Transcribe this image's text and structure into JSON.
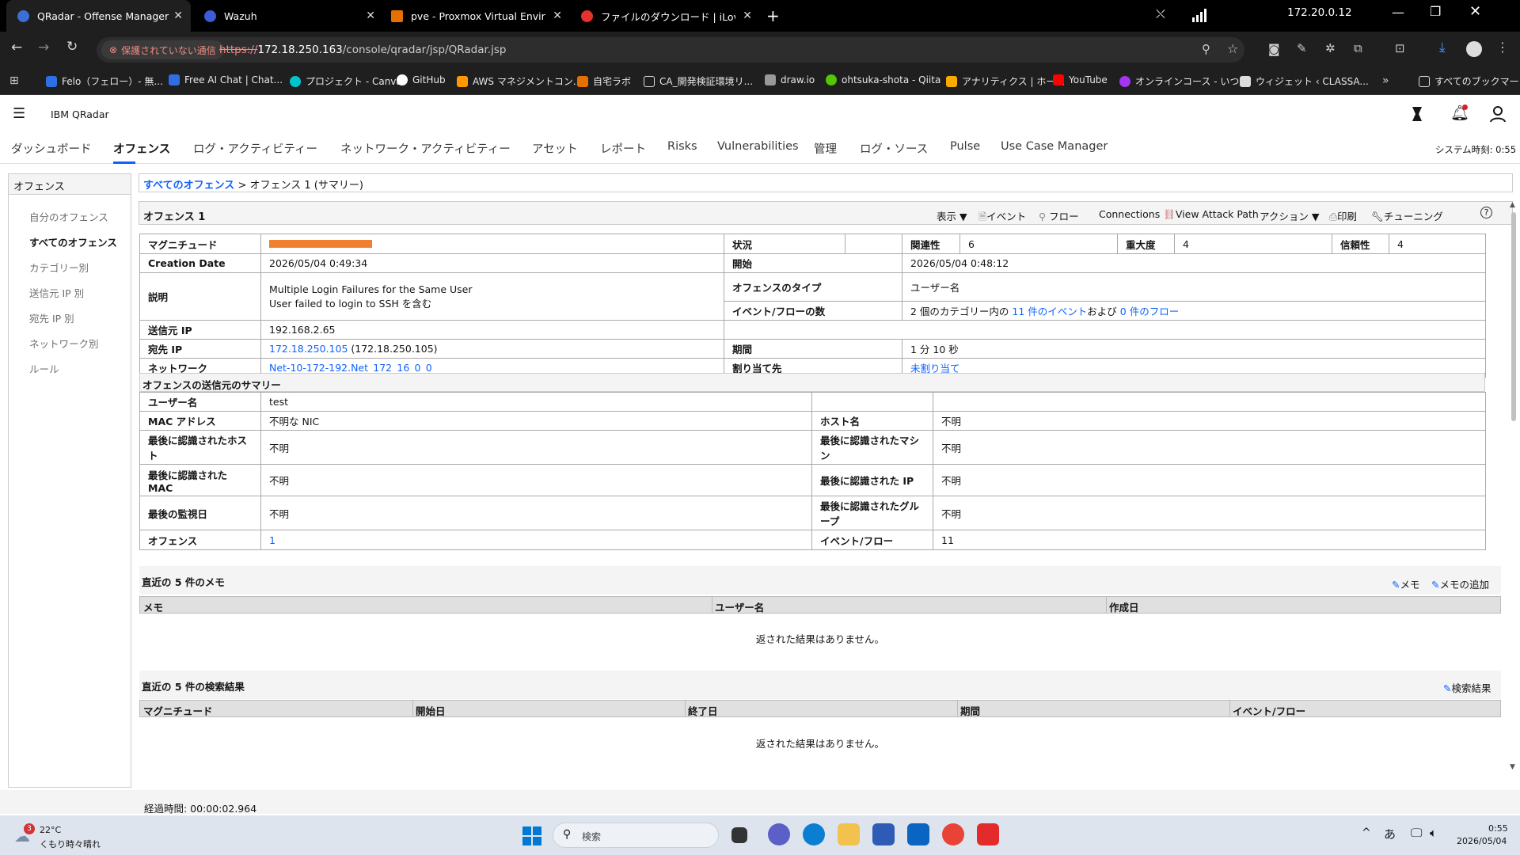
{
  "browser": {
    "tabs": [
      {
        "title": "QRadar - Offense Manager",
        "color": "#3b6fd4",
        "active": true
      },
      {
        "title": "Wazuh",
        "color": "#3b5bd8"
      },
      {
        "title": "pve - Proxmox Virtual Environm",
        "color": "#e57000"
      },
      {
        "title": "ファイルのダウンロード | iLovePDF",
        "color": "#e5322d"
      }
    ],
    "new_tab": "+",
    "ip": "172.20.0.12",
    "security_label": "保護されていない通信",
    "url_scheme": "https://",
    "url_host": "172.18.250.163",
    "url_path": "/console/qradar/jsp/QRadar.jsp",
    "bookmarks": [
      {
        "label": "Felo（フェロー）- 無...",
        "color": "#2f6fe4"
      },
      {
        "label": "Free AI Chat | Chat...",
        "color": "#2f6fe4"
      },
      {
        "label": "プロジェクト - Canva",
        "color": "#00c4cc"
      },
      {
        "label": "GitHub",
        "color": "#ffffff"
      },
      {
        "label": "AWS マネジメントコン...",
        "color": "#ff9900"
      },
      {
        "label": "自宅ラボ",
        "color": "#e57000"
      },
      {
        "label": "CA_開発検証環境リ...",
        "color": "#dddddd"
      },
      {
        "label": "draw.io",
        "color": "#999999"
      },
      {
        "label": "ohtsuka-shota - Qiita",
        "color": "#55c500"
      },
      {
        "label": "アナリティクス | ホーム",
        "color": "#f9ab00"
      },
      {
        "label": "YouTube",
        "color": "#ff0000"
      },
      {
        "label": "オンラインコース - いつ...",
        "color": "#a435f0"
      },
      {
        "label": "ウィジェット ‹ CLASSA...",
        "color": "#dddddd"
      }
    ],
    "more_bookmarks": "»",
    "all_bookmarks": "すべてのブックマーク"
  },
  "app": {
    "brand": "IBM QRadar",
    "system_time": "システム時刻: 0:55",
    "nav_tabs": [
      "ダッシュボード",
      "オフェンス",
      "ログ・アクティビティー",
      "ネットワーク・アクティビティー",
      "アセット",
      "レポート",
      "Risks",
      "Vulnerabilities",
      "管理",
      "ログ・ソース",
      "Pulse",
      "Use Case Manager"
    ],
    "active_tab": "オフェンス"
  },
  "sidebar": {
    "title": "オフェンス",
    "items": [
      "自分のオフェンス",
      "すべてのオフェンス",
      "カテゴリー別",
      "送信元 IP 別",
      "宛先 IP 別",
      "ネットワーク別",
      "ルール"
    ],
    "active": "すべてのオフェンス"
  },
  "breadcrumb": {
    "link": "すべてのオフェンス",
    "rest": " > オフェンス 1 (サマリー)"
  },
  "toolbar": {
    "title": "オフェンス 1",
    "display": "表示 ▼",
    "events": "イベント",
    "flows": "フロー",
    "connections": "Connections",
    "attack_path": "View Attack Path",
    "actions": "アクション ▼",
    "print": "印刷",
    "tuning": "チューニング",
    "help": "?"
  },
  "offense": {
    "magnitude_label": "マグニチュード",
    "magnitude_pct": 0.48,
    "status_label": "状況",
    "relevance_label": "関連性",
    "relevance": "6",
    "severity_label": "重大度",
    "severity": "4",
    "credibility_label": "信頼性",
    "credibility": "4",
    "creation_label": "Creation Date",
    "creation": "2026/05/04 0:49:34",
    "start_label": "開始",
    "start": "2026/05/04 0:48:12",
    "desc_label": "説明",
    "desc1": "Multiple Login Failures for the Same User",
    "desc2": "User failed to login to SSH を含む",
    "type_label": "オフェンスのタイプ",
    "type": "ユーザー名",
    "count_label": "イベント/フローの数",
    "count_pre": "2 個のカテゴリー内の ",
    "count_events": "11 件のイベント",
    "count_mid": "および ",
    "count_flows": "0 件のフロー",
    "src_label": "送信元 IP",
    "src": "192.168.2.65",
    "dst_label": "宛先 IP",
    "dst_link": "172.18.250.105",
    "dst_rest": " (172.18.250.105)",
    "duration_label": "期間",
    "duration": "1 分 10 秒",
    "network_label": "ネットワーク",
    "network": "Net-10-172-192.Net_172_16_0_0",
    "assign_label": "割り当て先",
    "assign": "未割り当て"
  },
  "source_summary": {
    "title": "オフェンスの送信元のサマリー",
    "user_label": "ユーザー名",
    "user": "test",
    "mac_label": "MAC アドレス",
    "mac": "不明な NIC",
    "host_label": "ホスト名",
    "host": "不明",
    "last_host_label": "最後に認識されたホスト",
    "last_host": "不明",
    "last_machine_label": "最後に認識されたマシン",
    "last_machine": "不明",
    "last_mac_label": "最後に認識された MAC",
    "last_mac": "不明",
    "last_ip_label": "最後に認識された IP",
    "last_ip": "不明",
    "last_obs_label": "最後の監視日",
    "last_obs": "不明",
    "last_group_label": "最後に認識されたグループ",
    "last_group": "不明",
    "offense_label": "オフェンス",
    "offense": "1",
    "ef_label": "イベント/フロー",
    "ef": "11"
  },
  "notes": {
    "title": "直近の 5 件のメモ",
    "memo_btn": "メモ",
    "add_btn": "メモの追加",
    "cols": [
      "メモ",
      "ユーザー名",
      "作成日"
    ],
    "empty": "返された結果はありません。"
  },
  "searches": {
    "title": "直近の 5 件の検索結果",
    "btn": "検索結果",
    "cols": [
      "マグニチュード",
      "開始日",
      "終了日",
      "期間",
      "イベント/フロー"
    ],
    "empty": "返された結果はありません。"
  },
  "footer": {
    "elapsed": "経過時間: 00:00:02.964"
  },
  "taskbar": {
    "weather_badge": "3",
    "temp": "22°C",
    "weather": "くもり時々晴れ",
    "search": "検索",
    "ime": "あ",
    "time": "0:55",
    "date": "2026/05/04"
  }
}
